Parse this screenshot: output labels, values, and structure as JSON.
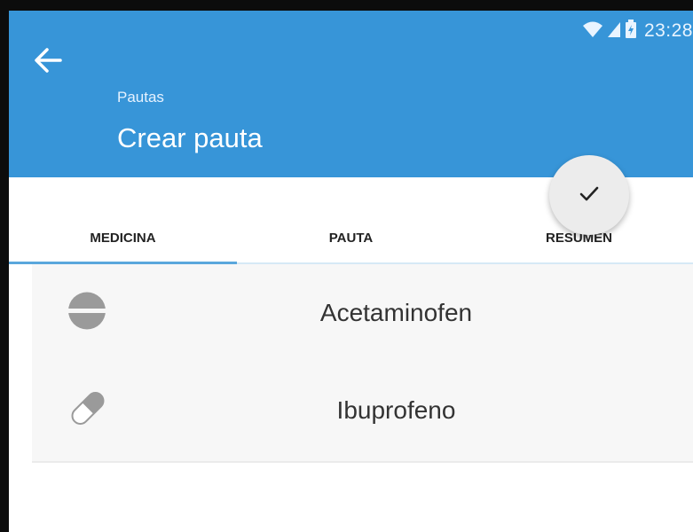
{
  "status_bar": {
    "time": "23:28"
  },
  "header": {
    "breadcrumb": "Pautas",
    "title": "Crear pauta"
  },
  "fab": {
    "icon": "check-icon"
  },
  "tabs": [
    {
      "label": "MEDICINA",
      "active": true
    },
    {
      "label": "PAUTA",
      "active": false
    },
    {
      "label": "RESUMEN",
      "active": false
    }
  ],
  "medicines": [
    {
      "name": "Acetaminofen",
      "icon": "tablet-icon"
    },
    {
      "name": "Ibuprofeno",
      "icon": "capsule-icon"
    }
  ],
  "colors": {
    "primary": "#3795d8",
    "tab_indicator": "#5aa7dc",
    "fab_background": "#ececec"
  }
}
